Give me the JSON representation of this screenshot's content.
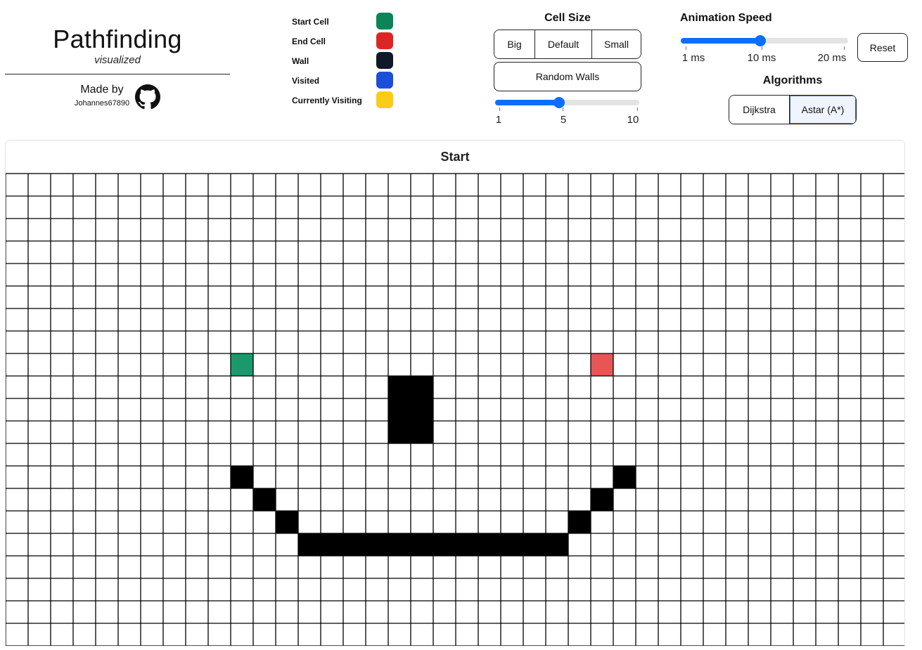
{
  "header": {
    "title": "Pathfinding",
    "subtitle": "visualized",
    "made_by_label": "Made by",
    "author": "Johannes67890"
  },
  "legend": [
    {
      "label": "Start Cell",
      "color": "#0b8457"
    },
    {
      "label": "End Cell",
      "color": "#dc2626"
    },
    {
      "label": "Wall",
      "color": "#111827"
    },
    {
      "label": "Visited",
      "color": "#1d4ed8"
    },
    {
      "label": "Currently Visiting",
      "color": "#facc15"
    }
  ],
  "cell_size": {
    "title": "Cell Size",
    "options": [
      "Big",
      "Default",
      "Small"
    ],
    "random_walls_label": "Random Walls",
    "slider": {
      "min": 1,
      "max": 10,
      "value": 5,
      "tick_labels": [
        "1",
        "5",
        "10"
      ]
    }
  },
  "animation_speed": {
    "title": "Animation Speed",
    "slider": {
      "min": 1,
      "max": 20,
      "value": 10,
      "tick_labels": [
        "1 ms",
        "10 ms",
        "20 ms"
      ]
    },
    "reset_label": "Reset"
  },
  "algorithms": {
    "title": "Algorithms",
    "options": [
      "Dijkstra",
      "Astar (A*)"
    ],
    "selected": "Astar (A*)"
  },
  "grid": {
    "start_label": "Start",
    "cols": 40,
    "rows": 21,
    "start_cell": {
      "row": 8,
      "col": 10,
      "color": "#1a9a6c"
    },
    "end_cell": {
      "row": 8,
      "col": 26,
      "color": "#e85555"
    },
    "walls": [
      [
        9,
        17
      ],
      [
        9,
        18
      ],
      [
        10,
        17
      ],
      [
        10,
        18
      ],
      [
        11,
        17
      ],
      [
        11,
        18
      ],
      [
        13,
        10
      ],
      [
        13,
        27
      ],
      [
        14,
        11
      ],
      [
        14,
        26
      ],
      [
        15,
        12
      ],
      [
        15,
        25
      ],
      [
        16,
        13
      ],
      [
        16,
        14
      ],
      [
        16,
        15
      ],
      [
        16,
        16
      ],
      [
        16,
        17
      ],
      [
        16,
        18
      ],
      [
        16,
        19
      ],
      [
        16,
        20
      ],
      [
        16,
        21
      ],
      [
        16,
        22
      ],
      [
        16,
        23
      ],
      [
        16,
        24
      ]
    ]
  },
  "colors": {
    "accent": "#0d6efd",
    "wall": "#000000",
    "grid_line": "#000000"
  }
}
